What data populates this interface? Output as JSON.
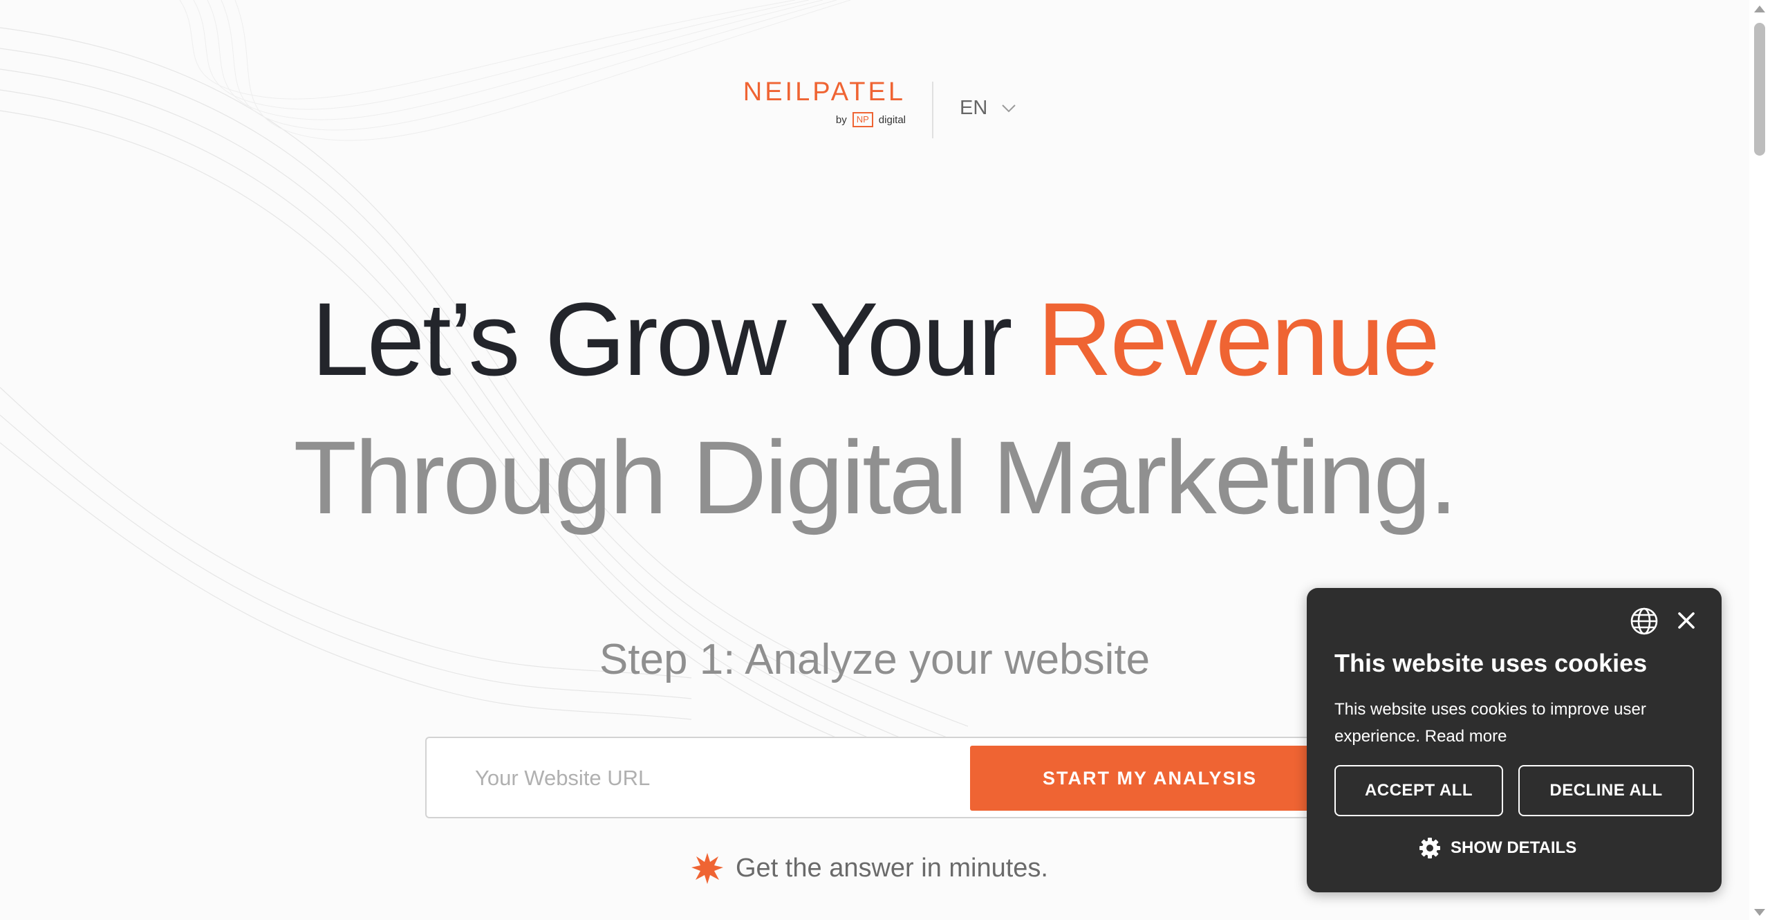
{
  "header": {
    "logo_word": "NEILPATEL",
    "logo_by": "by",
    "logo_np": "NP",
    "logo_digital": "digital",
    "language": "EN"
  },
  "hero": {
    "line1_main": "Let’s Grow Your ",
    "line1_accent": "Revenue",
    "line2": "Through Digital Marketing."
  },
  "step": {
    "title": "Step 1: Analyze your website",
    "url_placeholder": "Your Website URL",
    "start_label": "START MY ANALYSIS",
    "answer_text": "Get the answer in minutes."
  },
  "cookie": {
    "title": "This website uses cookies",
    "text": "This website uses cookies to improve user experience.",
    "read_more": "Read more",
    "accept_label": "ACCEPT ALL",
    "decline_label": "DECLINE ALL",
    "details_label": "SHOW DETAILS"
  },
  "colors": {
    "accent": "#ef6433",
    "heading_dark": "#23252b",
    "heading_grey": "#909090",
    "cookie_bg": "#2e2e2e"
  },
  "icons": [
    "chevron-down-icon",
    "starburst-icon",
    "globe-icon",
    "close-icon",
    "gear-icon"
  ]
}
